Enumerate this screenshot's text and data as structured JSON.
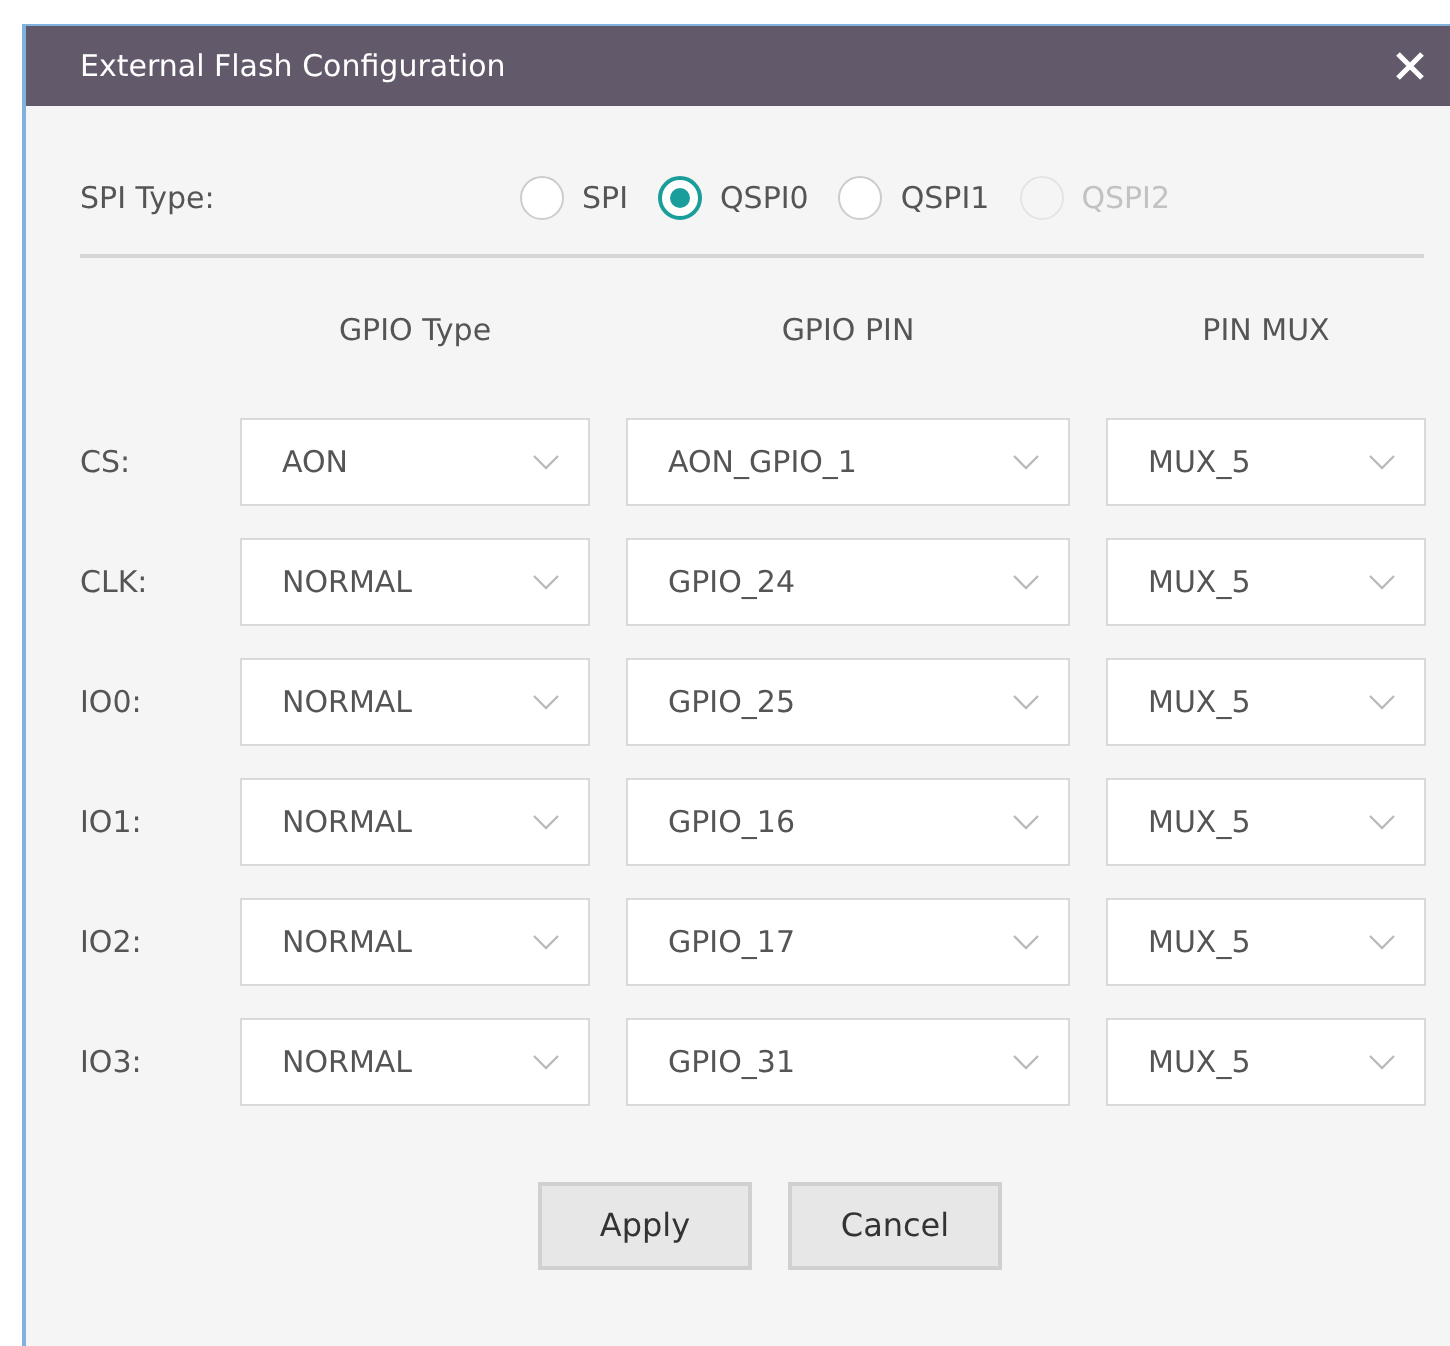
{
  "dialog": {
    "title": "External Flash Configuration"
  },
  "spi_type": {
    "label": "SPI Type:",
    "options": [
      {
        "label": "SPI",
        "selected": false,
        "disabled": false
      },
      {
        "label": "QSPI0",
        "selected": true,
        "disabled": false
      },
      {
        "label": "QSPI1",
        "selected": false,
        "disabled": false
      },
      {
        "label": "QSPI2",
        "selected": false,
        "disabled": true
      }
    ]
  },
  "columns": [
    "GPIO Type",
    "GPIO PIN",
    "PIN MUX"
  ],
  "rows": [
    {
      "label": "CS:",
      "gpio_type": "AON",
      "gpio_pin": "AON_GPIO_1",
      "pin_mux": "MUX_5"
    },
    {
      "label": "CLK:",
      "gpio_type": "NORMAL",
      "gpio_pin": "GPIO_24",
      "pin_mux": "MUX_5"
    },
    {
      "label": "IO0:",
      "gpio_type": "NORMAL",
      "gpio_pin": "GPIO_25",
      "pin_mux": "MUX_5"
    },
    {
      "label": "IO1:",
      "gpio_type": "NORMAL",
      "gpio_pin": "GPIO_16",
      "pin_mux": "MUX_5"
    },
    {
      "label": "IO2:",
      "gpio_type": "NORMAL",
      "gpio_pin": "GPIO_17",
      "pin_mux": "MUX_5"
    },
    {
      "label": "IO3:",
      "gpio_type": "NORMAL",
      "gpio_pin": "GPIO_31",
      "pin_mux": "MUX_5"
    }
  ],
  "buttons": [
    "Apply",
    "Cancel"
  ]
}
